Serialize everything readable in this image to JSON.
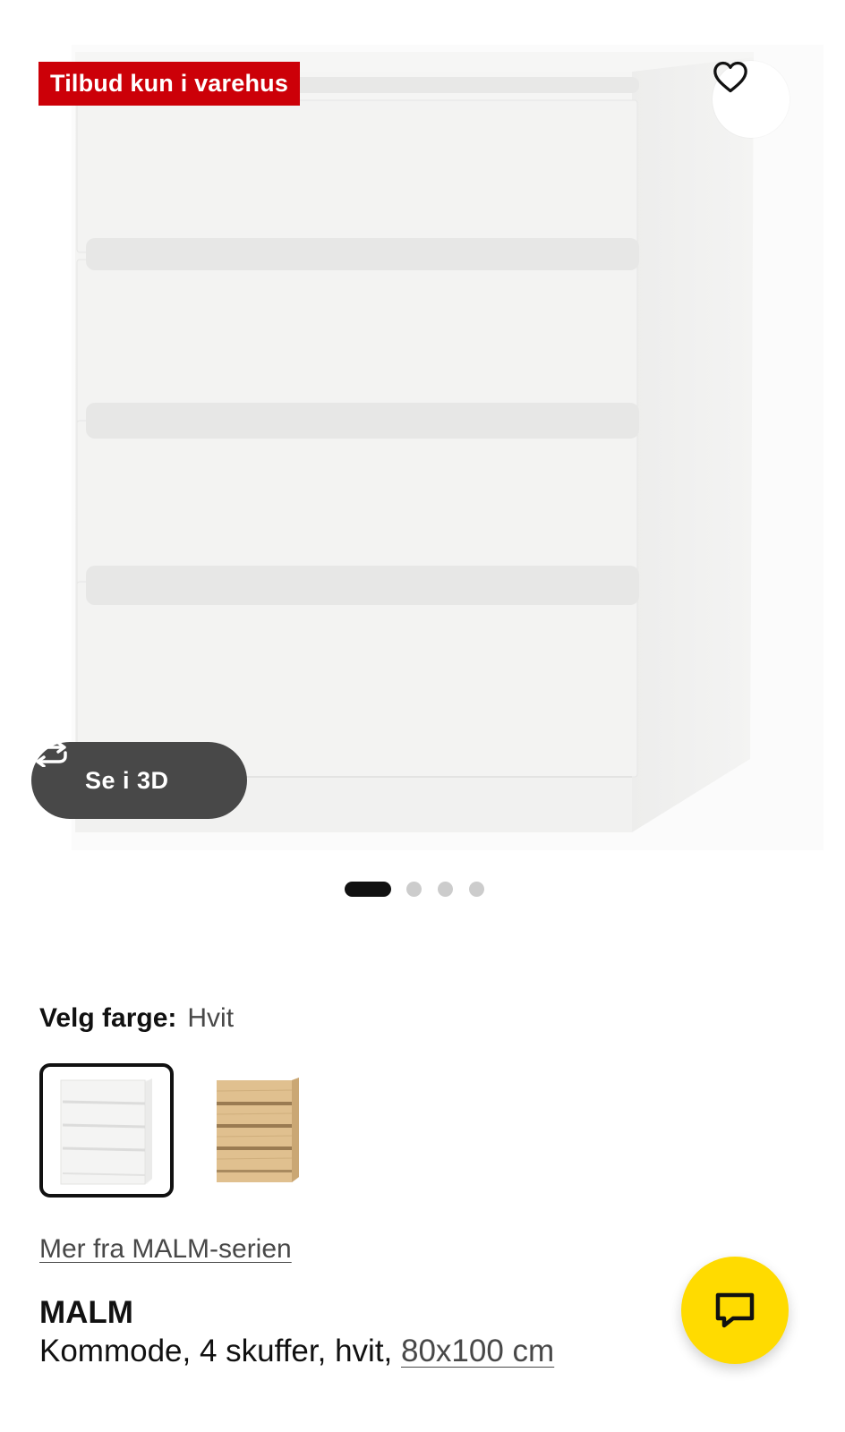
{
  "product_image": {
    "alt": "MALM Kommode, 4 skuffer, hvit",
    "badge": "Tilbud kun i varehus",
    "favorite_icon": "heart-outline-icon",
    "view_3d": {
      "label": "Se i 3D",
      "icon": "rotate-3d-icon"
    },
    "carousel": {
      "total": 4,
      "active_index": 0
    }
  },
  "color_selector": {
    "label": "Velg farge:",
    "selected_value": "Hvit",
    "options": [
      {
        "name": "Hvit",
        "selected": true
      },
      {
        "name": "Eik",
        "selected": false
      }
    ]
  },
  "series_link": "Mer fra MALM-serien",
  "product": {
    "name": "MALM",
    "description": "Kommode, 4 skuffer, hvit, ",
    "size": "80x100 cm"
  },
  "chat": {
    "icon": "chat-bubble-icon"
  },
  "colors": {
    "badge_red": "#cc0008",
    "chat_yellow": "#ffdb00",
    "view3d_dark": "#484848",
    "dot_active": "#111111",
    "dot_inactive": "#cccccc"
  }
}
